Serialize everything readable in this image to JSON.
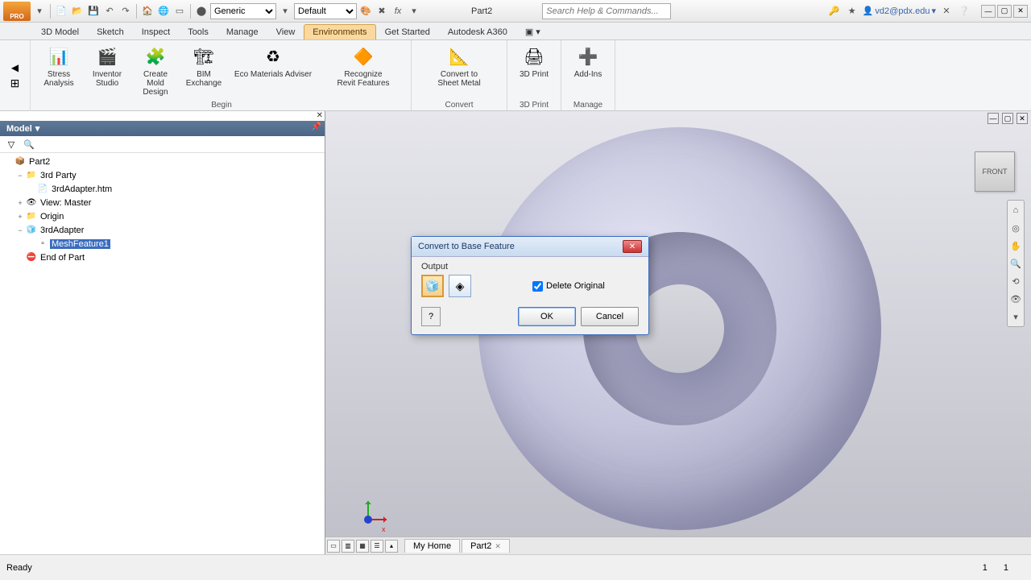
{
  "app": {
    "title": "Part2",
    "user": "vd2@pdx.edu"
  },
  "qat": {
    "material_dropdown": "Generic",
    "appearance_dropdown": "Default",
    "search_placeholder": "Search Help & Commands..."
  },
  "tabs": {
    "items": [
      "3D Model",
      "Sketch",
      "Inspect",
      "Tools",
      "Manage",
      "View",
      "Environments",
      "Get Started",
      "Autodesk A360"
    ],
    "active": "Environments"
  },
  "ribbon": {
    "panels": [
      {
        "title": "Begin",
        "buttons": [
          {
            "label": "Stress\nAnalysis",
            "icon": "📊"
          },
          {
            "label": "Inventor\nStudio",
            "icon": "🎬"
          },
          {
            "label": "Create\nMold Design",
            "icon": "🧩"
          },
          {
            "label": "BIM\nExchange",
            "icon": "🏗"
          },
          {
            "label": "Eco Materials Adviser",
            "icon": "♻"
          },
          {
            "label": "Recognize\nRevit Features",
            "icon": "🔶"
          }
        ]
      },
      {
        "title": "Convert",
        "buttons": [
          {
            "label": "Convert to\nSheet Metal",
            "icon": "📐"
          }
        ]
      },
      {
        "title": "3D Print",
        "buttons": [
          {
            "label": "3D Print",
            "icon": "🖨"
          }
        ]
      },
      {
        "title": "Manage",
        "buttons": [
          {
            "label": "Add-Ins",
            "icon": "➕"
          }
        ]
      }
    ]
  },
  "browser": {
    "header": "Model",
    "tree": [
      {
        "lvl": 0,
        "exp": "",
        "icon": "📦",
        "label": "Part2",
        "sel": false
      },
      {
        "lvl": 1,
        "exp": "−",
        "icon": "📁",
        "label": "3rd Party",
        "sel": false
      },
      {
        "lvl": 2,
        "exp": "",
        "icon": "📄",
        "label": "3rdAdapter.htm",
        "sel": false
      },
      {
        "lvl": 1,
        "exp": "+",
        "icon": "👁",
        "label": "View: Master",
        "sel": false
      },
      {
        "lvl": 1,
        "exp": "+",
        "icon": "📁",
        "label": "Origin",
        "sel": false
      },
      {
        "lvl": 1,
        "exp": "−",
        "icon": "🧊",
        "label": "3rdAdapter",
        "sel": false
      },
      {
        "lvl": 2,
        "exp": "",
        "icon": "▫",
        "label": "MeshFeature1",
        "sel": true
      },
      {
        "lvl": 1,
        "exp": "",
        "icon": "⛔",
        "label": "End of Part",
        "sel": false
      }
    ]
  },
  "dialog": {
    "title": "Convert to Base Feature",
    "output_label": "Output",
    "delete_original": "Delete Original",
    "delete_checked": true,
    "ok": "OK",
    "cancel": "Cancel"
  },
  "viewcube": {
    "face": "FRONT"
  },
  "doctabs": {
    "items": [
      "My Home",
      "Part2"
    ]
  },
  "status": {
    "text": "Ready",
    "num1": "1",
    "num2": "1"
  }
}
